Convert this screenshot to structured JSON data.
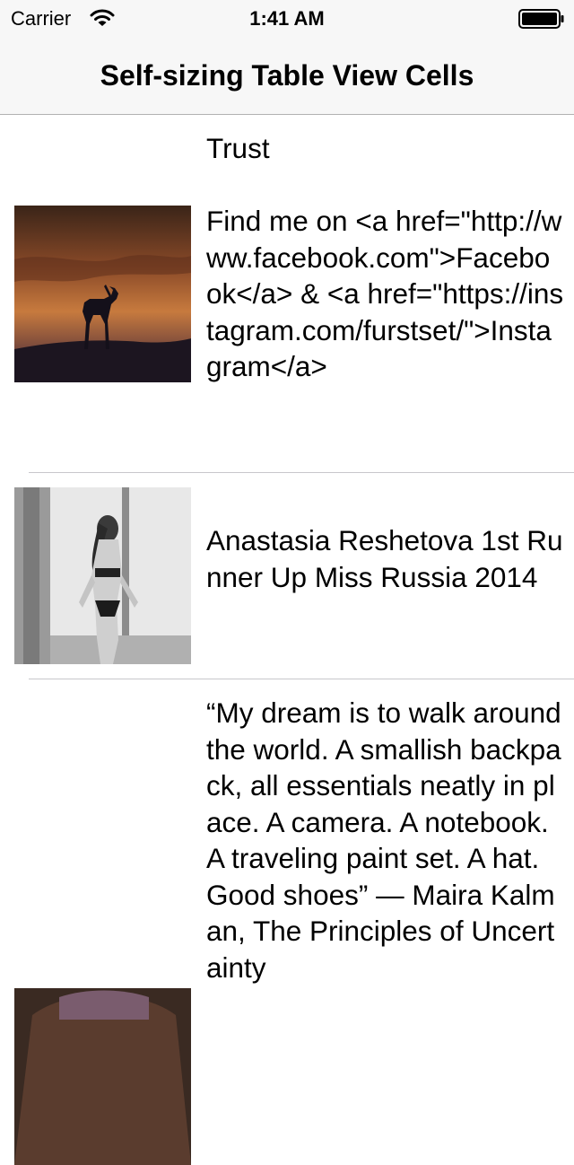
{
  "status_bar": {
    "carrier": "Carrier",
    "time": "1:41 AM",
    "wifi_icon": "wifi-icon",
    "battery_icon": "battery-icon"
  },
  "nav": {
    "title": "Self-sizing Table View Cells"
  },
  "cells": [
    {
      "text": "Trust"
    },
    {
      "text": "Find me on <a href=\"http://www.facebook.com\">Facebook</a> & <a href=\"https://instagram.com/furstset/\">Instagram</a>",
      "image": "sunset-antelope-photo"
    },
    {
      "text": "Anastasia Reshetova 1st Runner Up Miss Russia 2014",
      "image": "black-white-portrait-photo"
    },
    {
      "text": "“My dream is to walk around the world. A smallish backpack, all essentials neatly in place. A camera. A notebook. A traveling paint set. A hat. Good shoes” — Maira Kalman, The Principles of Uncertainty",
      "image": "partial-photo"
    }
  ],
  "colors": {
    "navbar_bg": "#f7f7f7",
    "separator": "#c8c7cc"
  }
}
